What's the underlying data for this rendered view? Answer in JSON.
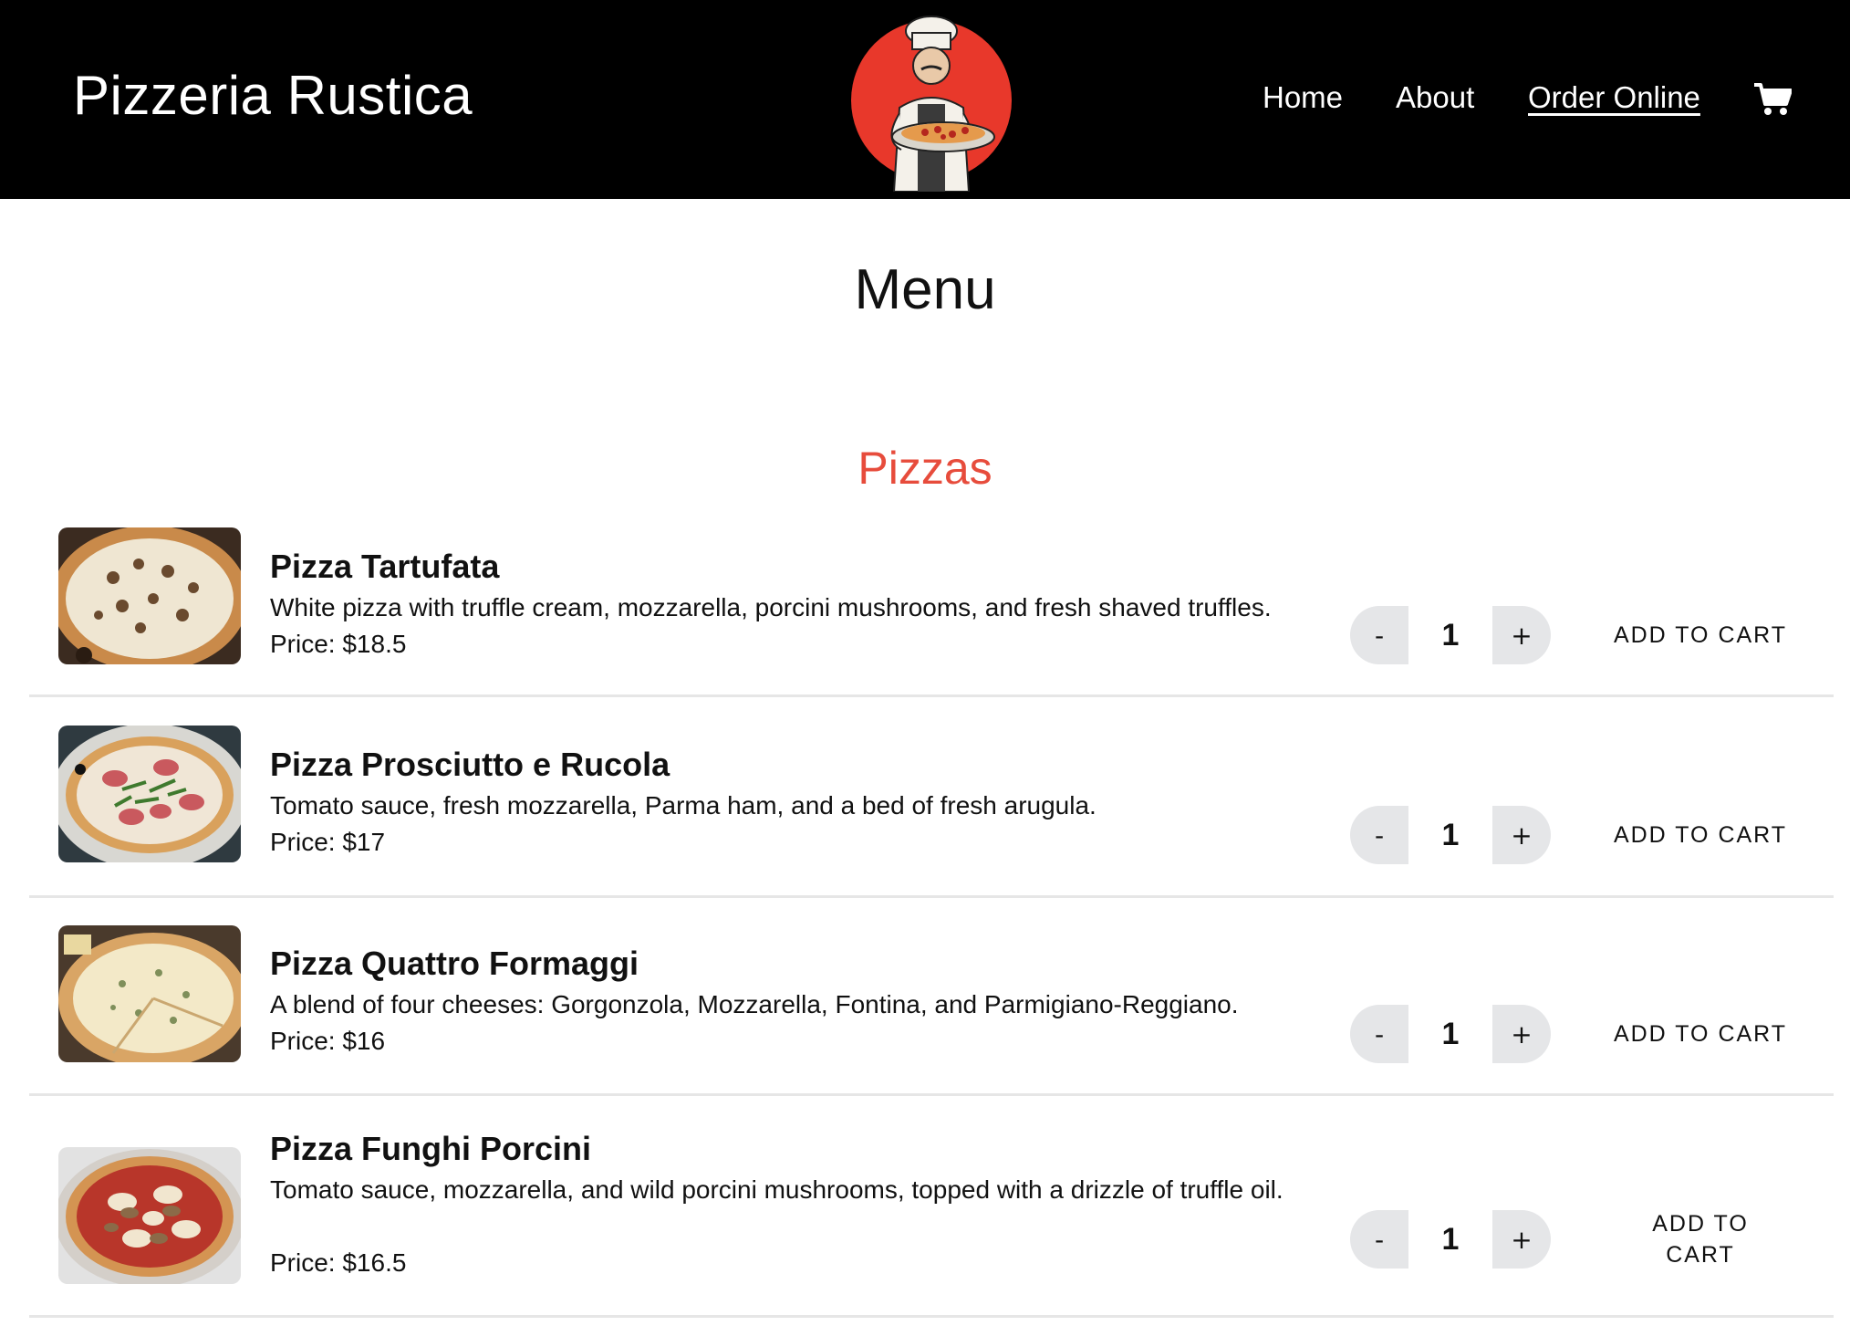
{
  "header": {
    "brand": "Pizzeria Rustica",
    "nav": [
      {
        "label": "Home"
      },
      {
        "label": "About"
      },
      {
        "label": "Order Online"
      }
    ],
    "logo_icon": "chef-holding-pizza-logo",
    "cart_icon": "shopping-cart-icon"
  },
  "main": {
    "title": "Menu",
    "section_title": "Pizzas",
    "items": [
      {
        "name": "Pizza Tartufata",
        "description": "White pizza with truffle cream, mozzarella, porcini mushrooms, and fresh shaved truffles.",
        "price": "Price: $18.5",
        "quantity": "1",
        "minus": "-",
        "plus": "+",
        "add_label": "ADD TO CART"
      },
      {
        "name": "Pizza Prosciutto e Rucola",
        "description": "Tomato sauce, fresh mozzarella, Parma ham, and a bed of fresh arugula.",
        "price": "Price: $17",
        "quantity": "1",
        "minus": "-",
        "plus": "+",
        "add_label": "ADD TO CART"
      },
      {
        "name": "Pizza Quattro Formaggi",
        "description": "A blend of four cheeses: Gorgonzola, Mozzarella, Fontina, and Parmigiano-Reggiano.",
        "price": "Price: $16",
        "quantity": "1",
        "minus": "-",
        "plus": "+",
        "add_label": "ADD TO CART"
      },
      {
        "name": "Pizza Funghi Porcini",
        "description": "Tomato sauce, mozzarella, and wild porcini mushrooms, topped with a drizzle of truffle oil.",
        "price": "Price: $16.5",
        "quantity": "1",
        "minus": "-",
        "plus": "+",
        "add_label": "ADD TO CART"
      }
    ]
  },
  "colors": {
    "header_bg": "#000000",
    "accent": "#e74c3c",
    "stepper_bg": "#e5e6e8",
    "divider": "#e6e6e6"
  }
}
